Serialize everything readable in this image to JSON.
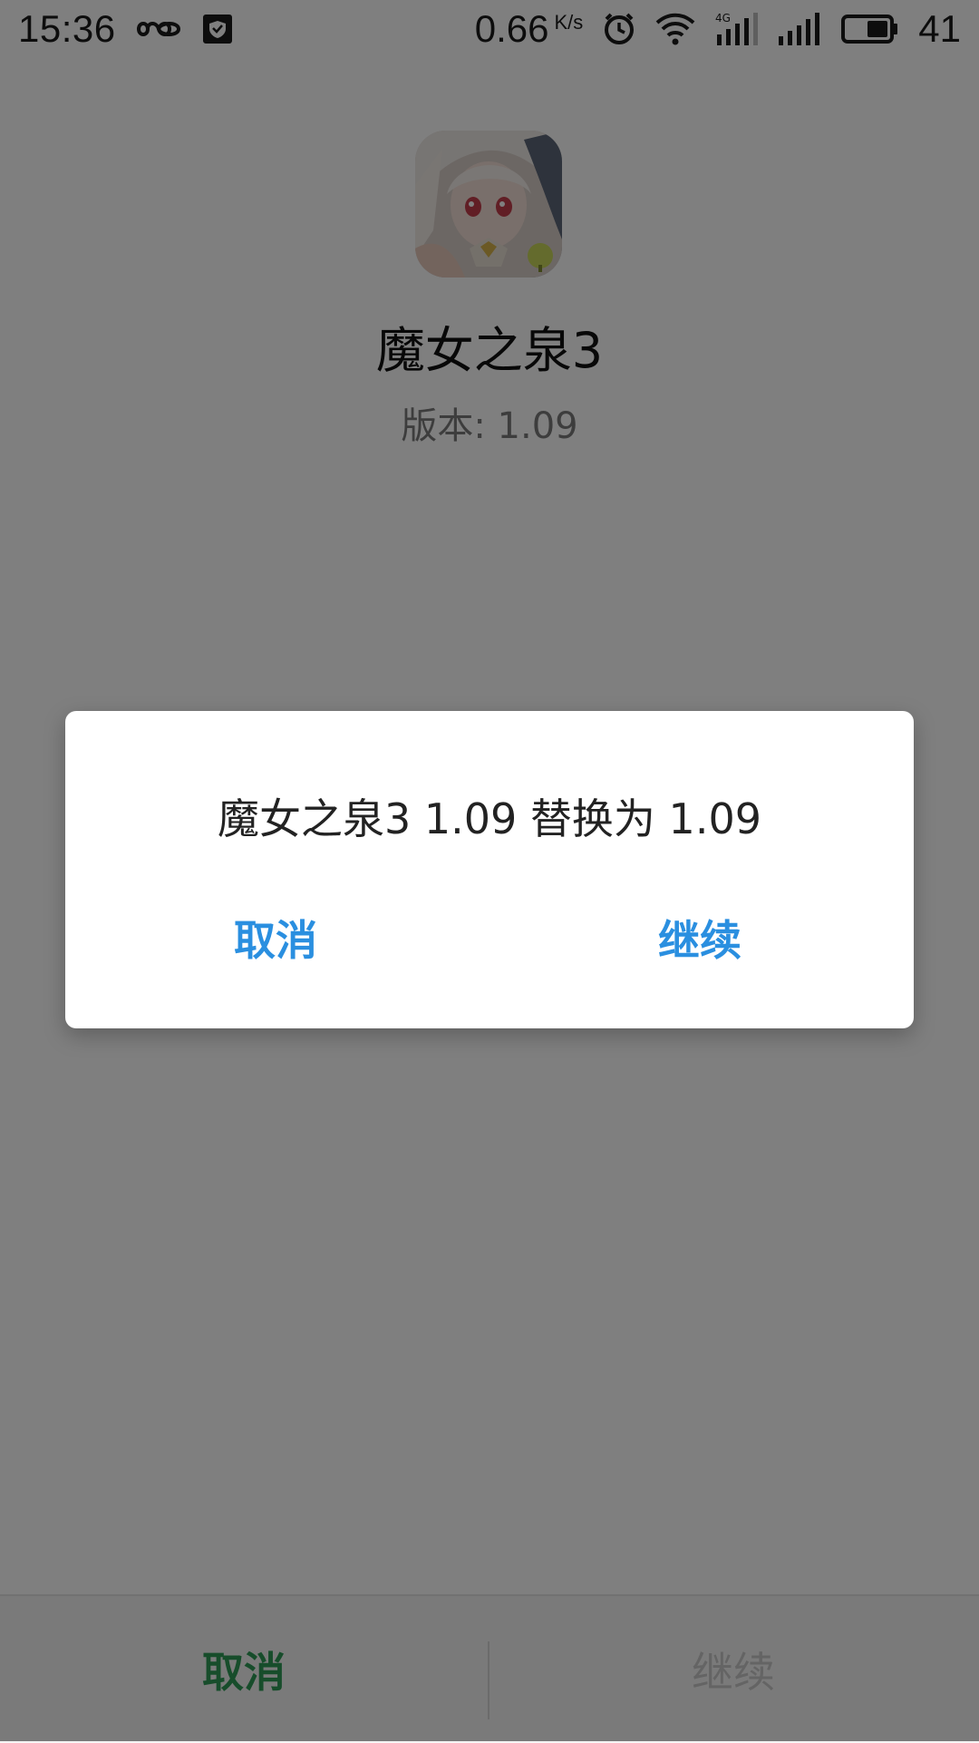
{
  "status_bar": {
    "time": "15:36",
    "left_icons": [
      "infinity-icon",
      "shield-check-icon"
    ],
    "network_speed": "0.66",
    "network_speed_unit": "K/s",
    "right_icons": [
      "alarm-clock-icon",
      "wifi-icon",
      "signal-4g-icon",
      "signal-icon",
      "battery-icon"
    ],
    "battery_level": "41",
    "network_type": "4G"
  },
  "app": {
    "name": "魔女之泉3",
    "version_label": "版本: 1.09",
    "icon": "app-icon"
  },
  "bottom_bar": {
    "cancel_label": "取消",
    "continue_label": "继续"
  },
  "dialog": {
    "message": "魔女之泉3 1.09 替换为 1.09",
    "cancel_label": "取消",
    "continue_label": "继续"
  },
  "colors": {
    "accent_blue": "#2a8fe0",
    "accent_green": "#2f9a57",
    "disabled_gray": "#c8c8c8",
    "scrim": "rgba(0,0,0,0.5)"
  }
}
